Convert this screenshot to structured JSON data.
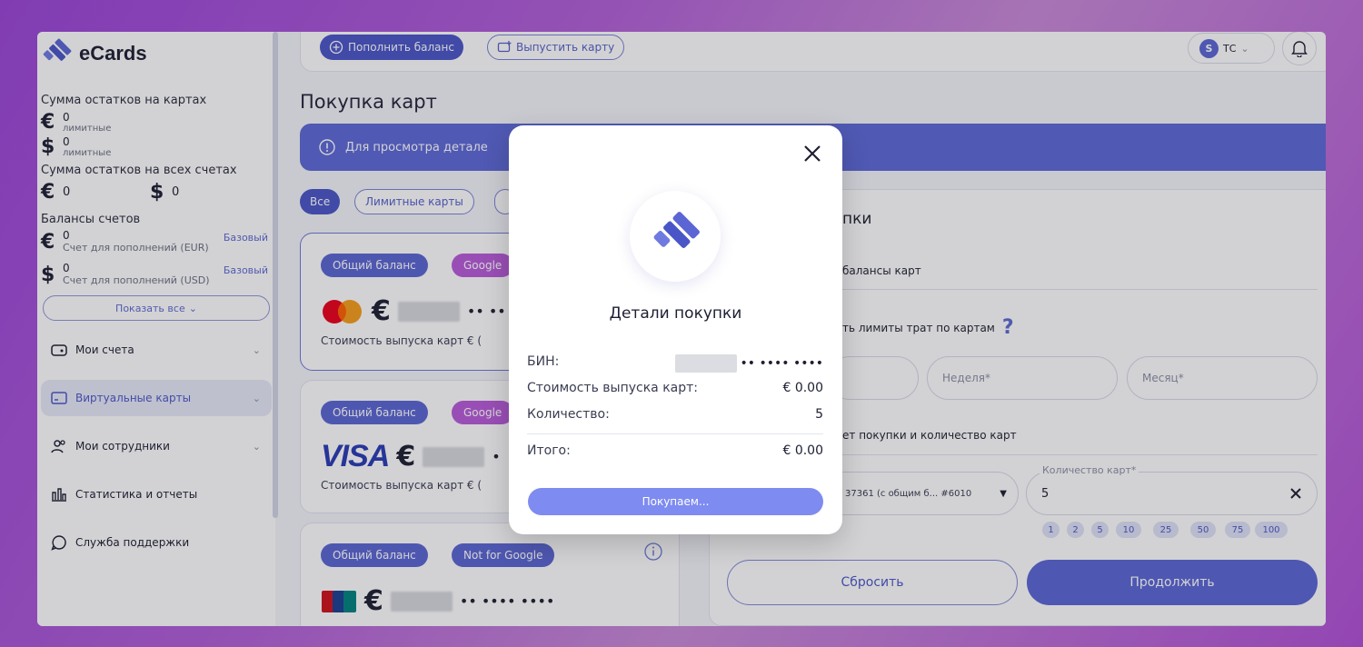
{
  "app": {
    "name": "eCards"
  },
  "sidebar": {
    "cards_balance_heading": "Сумма остатков на картах",
    "cards_balances": [
      {
        "currency": "€",
        "value": "0",
        "sub": "лимитные"
      },
      {
        "currency": "$",
        "value": "0",
        "sub": "лимитные"
      }
    ],
    "accounts_balance_heading": "Сумма остатков на всех счетах",
    "accounts_totals": [
      {
        "currency": "€",
        "value": "0"
      },
      {
        "currency": "$",
        "value": "0"
      }
    ],
    "account_balances_heading": "Балансы счетов",
    "accounts": [
      {
        "currency": "€",
        "value": "0",
        "name": "Счет для пополнений (EUR)",
        "type": "Базовый"
      },
      {
        "currency": "$",
        "value": "0",
        "name": "Счет для пополнений (USD)",
        "type": "Базовый"
      }
    ],
    "show_all": "Показать все",
    "menu": [
      {
        "label": "Мои счета",
        "icon": "wallet-icon"
      },
      {
        "label": "Виртуальные карты",
        "icon": "card-icon"
      },
      {
        "label": "Мои сотрудники",
        "icon": "users-icon"
      },
      {
        "label": "Статистика и отчеты",
        "icon": "chart-icon"
      },
      {
        "label": "Служба поддержки",
        "icon": "support-icon"
      }
    ]
  },
  "topbar": {
    "topup_label": "Пополнить баланс",
    "issue_label": "Выпустить карту",
    "user_initial": "S",
    "user_name": "ТС"
  },
  "page": {
    "title": "Покупка карт",
    "banner_text": "Для просмотра детале"
  },
  "filters": {
    "all": "Все",
    "limit": "Лимитные карты"
  },
  "cards": [
    {
      "balance_chip": "Общий баланс",
      "tag": "Google",
      "cost_label": "Стоимость выпуска карт € (",
      "mask": "•• ••",
      "brand": "mastercard"
    },
    {
      "balance_chip": "Общий баланс",
      "tag": "Google",
      "cost_label": "Стоимость выпуска карт € (",
      "mask": "•",
      "brand": "visa"
    },
    {
      "balance_chip": "Общий баланс",
      "tag": "Not for Google",
      "mask": "•• •••• ••••",
      "brand": "unionpay"
    }
  ],
  "right_panel": {
    "title": "пки",
    "balance_label": "балансы карт",
    "limits_label": "ть лимиты трат по картам",
    "week_placeholder": "Неделя*",
    "month_placeholder": "Месяц*",
    "purchase_label": "ет покупки и количество карт",
    "account_select": "37361 (с общим б... #6010",
    "quantity_label": "Количество карт*",
    "quantity_value": "5",
    "quantity_options": [
      "1",
      "2",
      "5",
      "10",
      "25",
      "50",
      "75",
      "100"
    ],
    "reset_label": "Сбросить",
    "continue_label": "Продолжить"
  },
  "modal": {
    "title": "Детали покупки",
    "bin_label": "БИН:",
    "bin_mask": "•• •••• ••••",
    "cost_label": "Стоимость выпуска карт:",
    "cost_value": "€ 0.00",
    "qty_label": "Количество:",
    "qty_value": "5",
    "total_label": "Итого:",
    "total_value": "€ 0.00",
    "button_label": "Покупаем..."
  },
  "colors": {
    "accent": "#5b66d4",
    "accent_dark": "#4a56c7",
    "google_chip": "#b85ad9",
    "banner": "#5d68d6"
  }
}
